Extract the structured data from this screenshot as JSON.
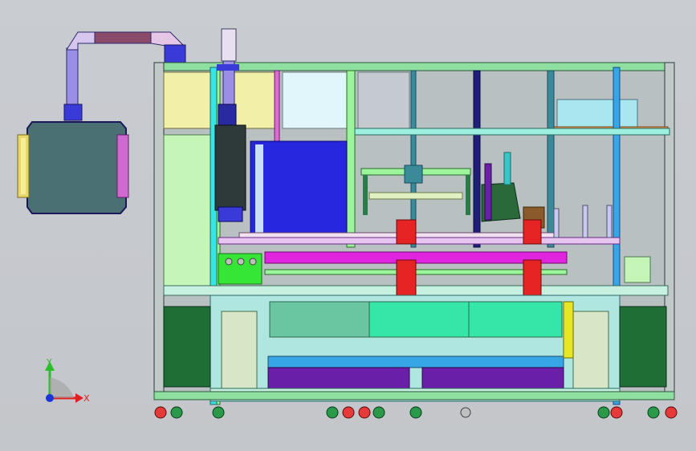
{
  "viewport": {
    "background": "#c6c9cd"
  },
  "axis_triad": {
    "x_label": "X",
    "y_label": "Y",
    "x_color": "#e0201c",
    "y_color": "#2bbf2b",
    "z_color": "#1a35d8"
  },
  "colors": {
    "frame_green": "#9cf59c",
    "frame_cyan": "#36e6e6",
    "frame_magenta": "#e024e0",
    "panel_yellow": "#f2f0a8",
    "panel_lightgreen": "#c6f5b8",
    "panel_darkgreen": "#1f6e36",
    "hood_teal": "#4a7074",
    "blue_panel": "#2727e0",
    "red_block": "#e62424",
    "purple": "#6a1fa8"
  }
}
